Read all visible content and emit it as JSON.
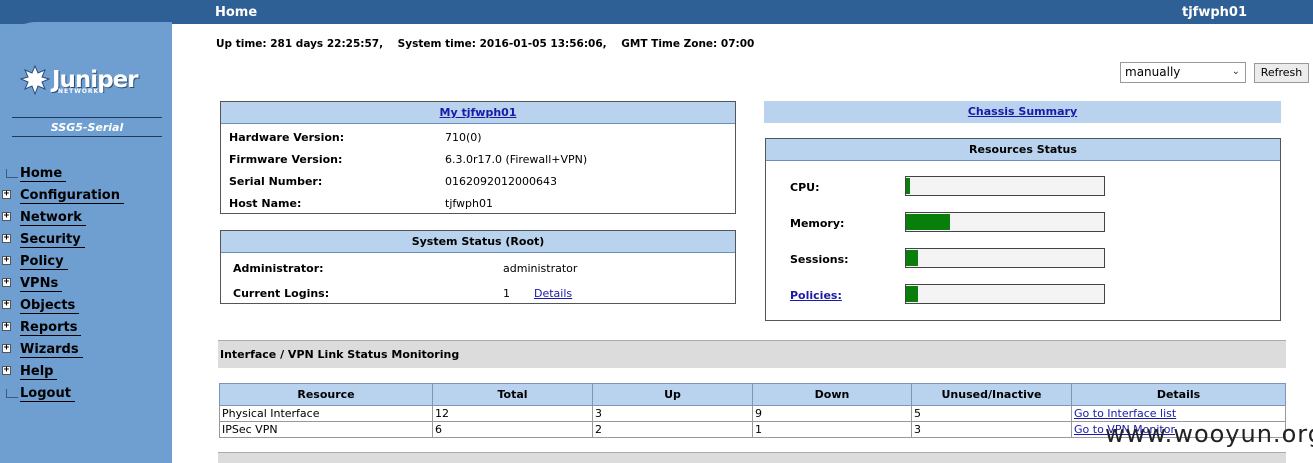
{
  "header": {
    "title": "Home",
    "hostname": "tjfwph01"
  },
  "sidebar": {
    "logo_text": "Juniper",
    "logo_sub": "NETWORKS",
    "model": "SSG5-Serial",
    "items": [
      {
        "label": "Home",
        "expandable": false
      },
      {
        "label": "Configuration",
        "expandable": true
      },
      {
        "label": "Network",
        "expandable": true
      },
      {
        "label": "Security",
        "expandable": true
      },
      {
        "label": "Policy",
        "expandable": true
      },
      {
        "label": "VPNs",
        "expandable": true
      },
      {
        "label": "Objects",
        "expandable": true
      },
      {
        "label": "Reports",
        "expandable": true
      },
      {
        "label": "Wizards",
        "expandable": true
      },
      {
        "label": "Help",
        "expandable": true
      },
      {
        "label": "Logout",
        "expandable": false
      }
    ]
  },
  "status_line": "Up time: 281 days 22:25:57,    System time: 2016-01-05 13:56:06,    GMT Time Zone: 07:00",
  "refresh": {
    "mode": "manually",
    "button": "Refresh"
  },
  "device_panel": {
    "title": "My tjfwph01",
    "rows": [
      {
        "key": "Hardware Version:",
        "value": "710(0)"
      },
      {
        "key": "Firmware Version:",
        "value": "6.3.0r17.0 (Firewall+VPN)"
      },
      {
        "key": "Serial Number:",
        "value": "0162092012000643"
      },
      {
        "key": "Host Name:",
        "value": "tjfwph01"
      }
    ]
  },
  "system_status": {
    "title": "System Status  (Root)",
    "admin_key": "Administrator:",
    "admin_value": "administrator",
    "logins_key": "Current Logins:",
    "logins_value": "1",
    "details_link": "Details"
  },
  "chassis": {
    "link": "Chassis Summary"
  },
  "resources": {
    "title": "Resources Status",
    "items": [
      {
        "label": "CPU:",
        "percent": 2,
        "link": false
      },
      {
        "label": "Memory:",
        "percent": 22,
        "link": false
      },
      {
        "label": "Sessions:",
        "percent": 6,
        "link": false
      },
      {
        "label": "Policies:",
        "percent": 6,
        "link": true
      }
    ]
  },
  "link_monitor": {
    "title": "Interface / VPN Link Status Monitoring",
    "columns": [
      "Resource",
      "Total",
      "Up",
      "Down",
      "Unused/Inactive",
      "Details"
    ],
    "rows": [
      [
        "Physical Interface",
        "12",
        "3",
        "9",
        "5",
        "Go to Interface list"
      ],
      [
        "IPSec VPN",
        "6",
        "2",
        "1",
        "3",
        "Go to VPN Monitor"
      ]
    ]
  },
  "watermark": "www.wooyun.org",
  "colors": {
    "header_blue": "#2e5f95",
    "sidebar_blue": "#6f9ed0",
    "panel_head": "#b9d3ef",
    "bar_green": "#0a7e0a"
  }
}
